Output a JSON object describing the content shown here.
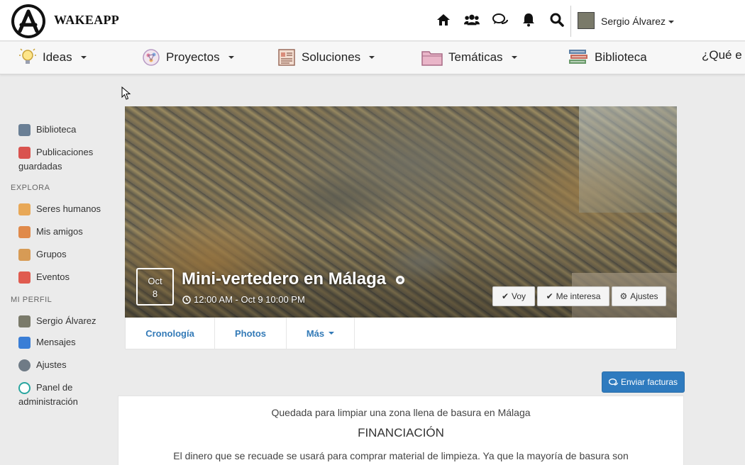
{
  "header": {
    "brand": "WAKEAPP",
    "user_name": "Sergio Álvarez"
  },
  "menu": {
    "items": [
      {
        "label": "Ideas",
        "icon": "lightbulb-icon",
        "has_dropdown": true
      },
      {
        "label": "Proyectos",
        "icon": "brain-network-icon",
        "has_dropdown": true
      },
      {
        "label": "Soluciones",
        "icon": "document-list-icon",
        "has_dropdown": true
      },
      {
        "label": "Temáticas",
        "icon": "folder-icon",
        "has_dropdown": true
      },
      {
        "label": "Biblioteca",
        "icon": "books-icon",
        "has_dropdown": false
      },
      {
        "label": "¿Qué e",
        "icon": "",
        "has_dropdown": false
      }
    ]
  },
  "sidebar": {
    "biblioteca": "Biblioteca",
    "publicaciones": "Publicaciones",
    "guardadas": "guardadas",
    "explora_heading": "EXPLORA",
    "seres_humanos": "Seres humanos",
    "mis_amigos": "Mis amigos",
    "grupos": "Grupos",
    "eventos": "Eventos",
    "mi_perfil_heading": "MI PERFIL",
    "perfil": "Sergio Álvarez",
    "mensajes": "Mensajes",
    "ajustes": "Ajustes",
    "panel": "Panel de",
    "administracion": "administración"
  },
  "event": {
    "month": "Oct",
    "day": "8",
    "title": "Mini-vertedero en Málaga",
    "time": "12:00 AM - Oct 9 10:00 PM",
    "btn_voy": "Voy",
    "btn_interesa": "Me interesa",
    "btn_ajustes": "Ajustes"
  },
  "tabs": {
    "cronologia": "Cronología",
    "photos": "Photos",
    "mas": "Más"
  },
  "send_button": "Enviar facturas",
  "content": {
    "description": "Quedada para limpiar una zona llena de basura en Málaga",
    "section_title": "FINANCIACIÓN",
    "paragraph": "El dinero que se recuade se usará para comprar material de limpieza. Ya que la mayoría de basura son"
  },
  "colors": {
    "primary_blue": "#2f7bbf",
    "link_blue": "#337ab7",
    "background": "#ebebeb"
  }
}
